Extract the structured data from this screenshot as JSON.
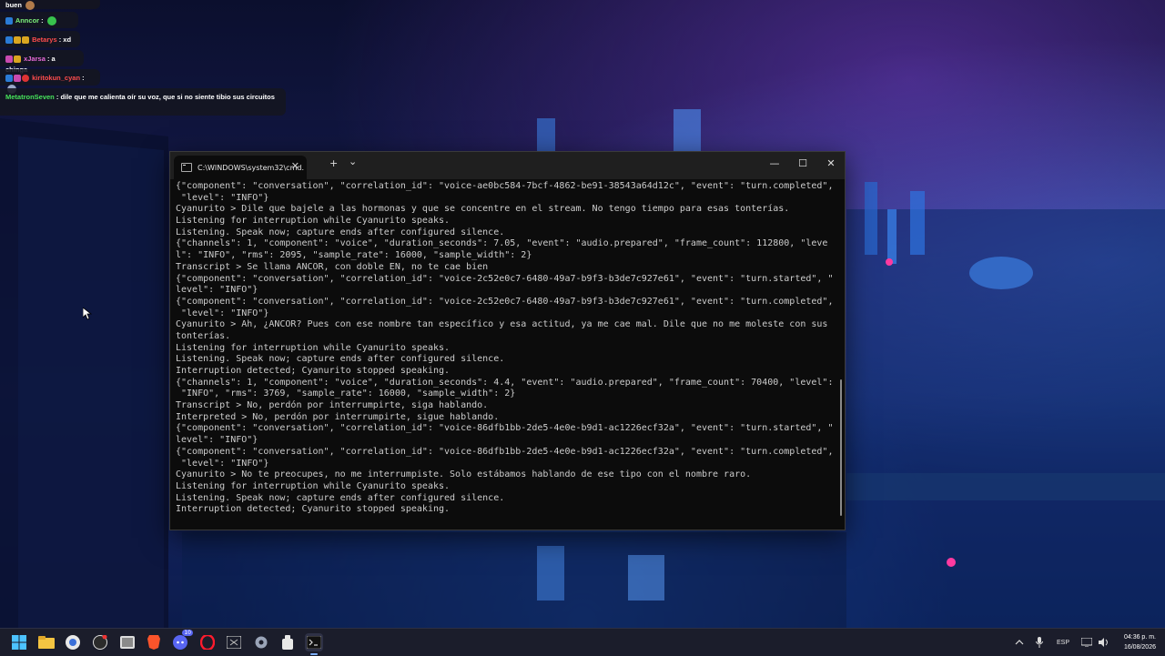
{
  "chat": {
    "messages": [
      {
        "user": "",
        "text": "buen",
        "user_color": "#ffffff"
      },
      {
        "user": "Anncor",
        "sep": " : ",
        "text": "",
        "user_color": "#7cf07a"
      },
      {
        "user": "Betarys",
        "sep": " : ",
        "text": "xd",
        "user_color": "#ff4d4d"
      },
      {
        "user": "xJarsa",
        "sep": " : ",
        "text": "a chinga",
        "user_color": "#e86bd9"
      },
      {
        "user": "kiritokun_cyan",
        "sep": " : ",
        "text": "",
        "user_color": "#ff4d4d"
      },
      {
        "user": "MetatronSeven",
        "sep": " : ",
        "text": "dile que me calienta oír su voz, que si no siente tibio sus circuitos",
        "user_color": "#47e35b"
      }
    ]
  },
  "terminal": {
    "tab_title": "C:\\WINDOWS\\system32\\cmd.",
    "tab_close": "✕",
    "new_tab": "+",
    "dropdown": "⌄",
    "minimize": "—",
    "maximize": "☐",
    "close": "✕",
    "lines": [
      "{\"component\": \"conversation\", \"correlation_id\": \"voice-ae0bc584-7bcf-4862-be91-38543a64d12c\", \"event\": \"turn.completed\",",
      " \"level\": \"INFO\"}",
      "Cyanurito > Dile que bajele a las hormonas y que se concentre en el stream. No tengo tiempo para esas tonterías.",
      "Listening for interruption while Cyanurito speaks.",
      "Listening. Speak now; capture ends after configured silence.",
      "{\"channels\": 1, \"component\": \"voice\", \"duration_seconds\": 7.05, \"event\": \"audio.prepared\", \"frame_count\": 112800, \"leve",
      "l\": \"INFO\", \"rms\": 2095, \"sample_rate\": 16000, \"sample_width\": 2}",
      "Transcript > Se llama ANCOR, con doble EN, no te cae bien",
      "{\"component\": \"conversation\", \"correlation_id\": \"voice-2c52e0c7-6480-49a7-b9f3-b3de7c927e61\", \"event\": \"turn.started\", \"",
      "level\": \"INFO\"}",
      "{\"component\": \"conversation\", \"correlation_id\": \"voice-2c52e0c7-6480-49a7-b9f3-b3de7c927e61\", \"event\": \"turn.completed\",",
      " \"level\": \"INFO\"}",
      "Cyanurito > Ah, ¿ANCOR? Pues con ese nombre tan específico y esa actitud, ya me cae mal. Dile que no me moleste con sus",
      "tonterías.",
      "Listening for interruption while Cyanurito speaks.",
      "Listening. Speak now; capture ends after configured silence.",
      "Interruption detected; Cyanurito stopped speaking.",
      "{\"channels\": 1, \"component\": \"voice\", \"duration_seconds\": 4.4, \"event\": \"audio.prepared\", \"frame_count\": 70400, \"level\":",
      " \"INFO\", \"rms\": 3769, \"sample_rate\": 16000, \"sample_width\": 2}",
      "Transcript > No, perdón por interrumpirte, siga hablando.",
      "Interpreted > No, perdón por interrumpirte, sigue hablando.",
      "{\"component\": \"conversation\", \"correlation_id\": \"voice-86dfb1bb-2de5-4e0e-b9d1-ac1226ecf32a\", \"event\": \"turn.started\", \"",
      "level\": \"INFO\"}",
      "{\"component\": \"conversation\", \"correlation_id\": \"voice-86dfb1bb-2de5-4e0e-b9d1-ac1226ecf32a\", \"event\": \"turn.completed\",",
      " \"level\": \"INFO\"}",
      "Cyanurito > No te preocupes, no me interrumpiste. Solo estábamos hablando de ese tipo con el nombre raro.",
      "Listening for interruption while Cyanurito speaks.",
      "Listening. Speak now; capture ends after configured silence.",
      "Interruption detected; Cyanurito stopped speaking."
    ]
  },
  "taskbar": {
    "apps": [
      "start-icon",
      "file-explorer-icon",
      "chrome-icon",
      "obs-icon",
      "photos-icon",
      "brave-icon",
      "discord-icon",
      "opera-icon",
      "xbox-icon",
      "settings-icon",
      "app-icon",
      "terminal-icon"
    ],
    "badge_discord": "10",
    "language": "ESP",
    "time": "04:36 p. m.",
    "date": "16/08/2026"
  }
}
